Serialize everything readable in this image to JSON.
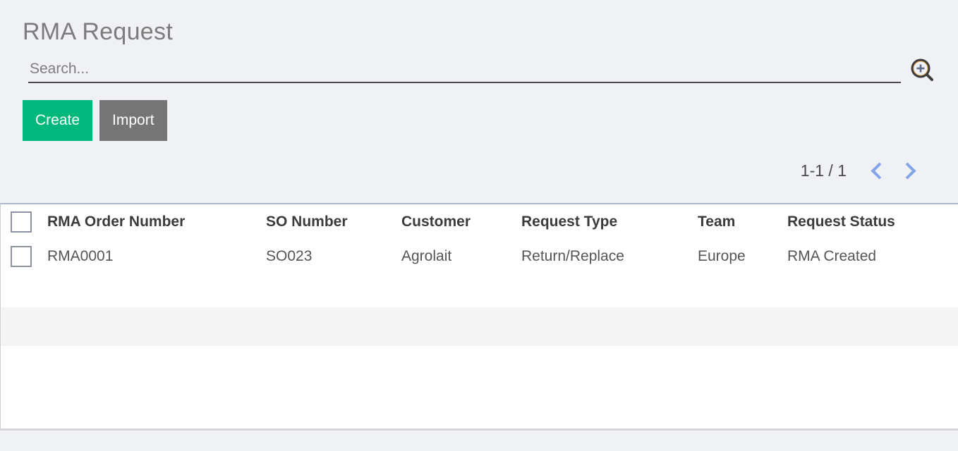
{
  "page": {
    "title": "RMA Request",
    "background_color": "#eff1f5"
  },
  "search": {
    "placeholder": "Search...",
    "value": "",
    "icon": "search-zoom-in-icon"
  },
  "toolbar": {
    "create_label": "Create",
    "import_label": "Import",
    "create_color": "#00b87c",
    "import_color": "#757575"
  },
  "pager": {
    "range_label": "1-1 / 1",
    "prev_icon": "chevron-left-icon",
    "next_icon": "chevron-right-icon",
    "chevron_color": "#82a4e8"
  },
  "table": {
    "columns": [
      {
        "key": "select",
        "label": ""
      },
      {
        "key": "rma_order_number",
        "label": "RMA Order Number"
      },
      {
        "key": "so_number",
        "label": "SO Number"
      },
      {
        "key": "customer",
        "label": "Customer"
      },
      {
        "key": "request_type",
        "label": "Request Type"
      },
      {
        "key": "team",
        "label": "Team"
      },
      {
        "key": "request_status",
        "label": "Request Status"
      }
    ],
    "rows": [
      {
        "rma_order_number": "RMA0001",
        "so_number": "SO023",
        "customer": "Agrolait",
        "request_type": "Return/Replace",
        "team": "Europe",
        "request_status": "RMA Created"
      }
    ]
  }
}
